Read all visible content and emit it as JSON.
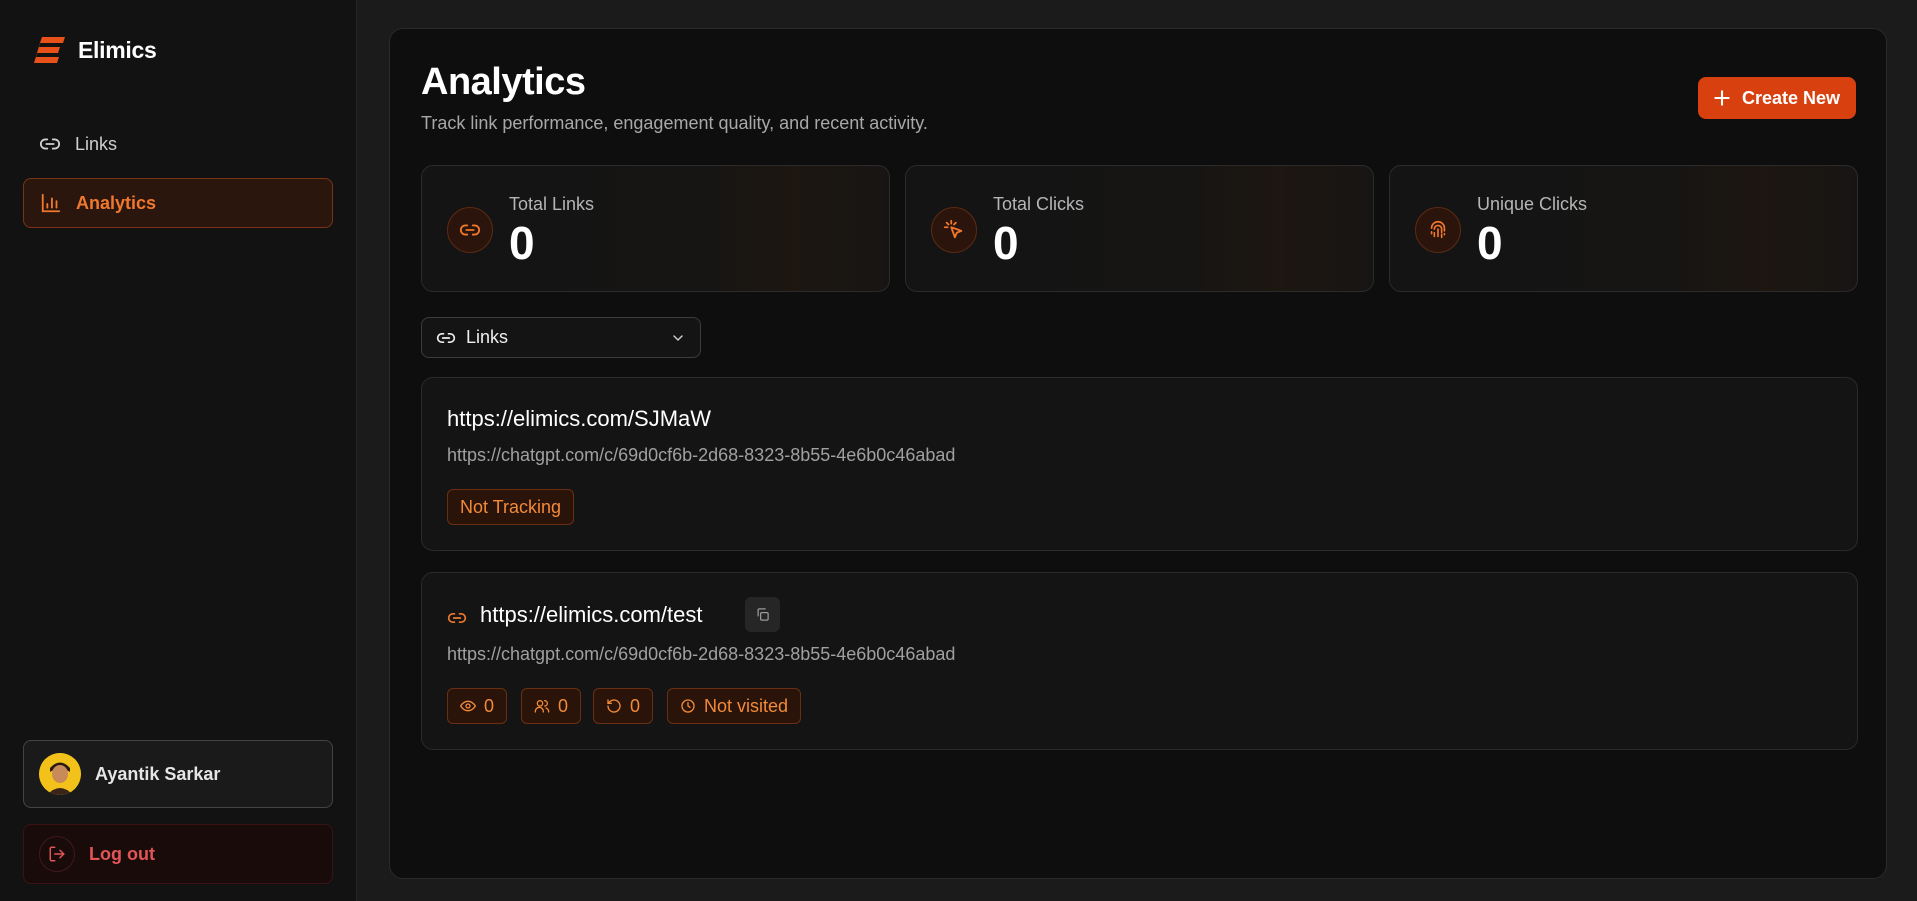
{
  "app": {
    "name": "Elimics"
  },
  "sidebar": {
    "items": [
      {
        "label": "Links",
        "icon": "link-icon",
        "active": false
      },
      {
        "label": "Analytics",
        "icon": "bar-chart-icon",
        "active": true
      }
    ],
    "user": {
      "name": "Ayantik Sarkar",
      "icon": "avatar"
    },
    "logout_label": "Log out"
  },
  "header": {
    "title": "Analytics",
    "subtitle": "Track link performance, engagement quality, and recent activity.",
    "create_label": "Create New"
  },
  "stats": [
    {
      "label": "Total Links",
      "value": "0",
      "icon": "link-icon"
    },
    {
      "label": "Total Clicks",
      "value": "0",
      "icon": "cursor-click-icon"
    },
    {
      "label": "Unique Clicks",
      "value": "0",
      "icon": "fingerprint-icon"
    }
  ],
  "filter": {
    "selected": "Links",
    "icon": "link-icon"
  },
  "links": [
    {
      "short_url": "https://elimics.com/SJMaW",
      "destination": "https://chatgpt.com/c/69d0cf6b-2d68-8323-8b55-4e6b0c46abad",
      "status": "Not Tracking"
    },
    {
      "short_url": "https://elimics.com/test",
      "destination": "https://chatgpt.com/c/69d0cf6b-2d68-8323-8b55-4e6b0c46abad",
      "metrics": {
        "views": "0",
        "visitors": "0",
        "returns": "0",
        "last_visit": "Not visited"
      }
    }
  ],
  "colors": {
    "accent": "#d9400f",
    "accent_text": "#f0782e",
    "danger": "#e05555",
    "background": "#0e0e0e"
  }
}
